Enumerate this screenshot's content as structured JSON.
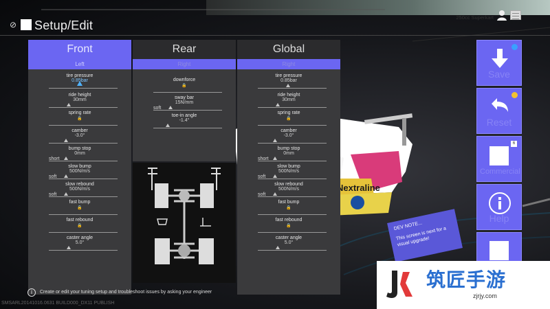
{
  "app": {
    "title": "Setup/Edit",
    "user_label": "250cc Superkart",
    "build_info": "SMSARL20141016.0631 BUILD000_DX11 PUBLISH"
  },
  "panels": [
    {
      "header": "Front",
      "sub": "Left",
      "active": true,
      "params": [
        {
          "label": "tire pressure",
          "value": "0.85bar",
          "highlight": true
        },
        {
          "label": "ride height",
          "value": "30mm"
        },
        {
          "label": "spring rate",
          "value": "",
          "locked": true
        },
        {
          "label": "camber",
          "value": "-3.0°"
        },
        {
          "label": "bump stop",
          "value": "0mm",
          "side": "short"
        },
        {
          "label": "slow bump",
          "value": "500N/m/s",
          "side": "soft"
        },
        {
          "label": "slow rebound",
          "value": "500N/m/s",
          "side": "soft"
        },
        {
          "label": "fast bump",
          "value": "",
          "locked": true
        },
        {
          "label": "fast rebound",
          "value": "",
          "locked": true
        },
        {
          "label": "caster angle",
          "value": "5.0°"
        }
      ]
    },
    {
      "header": "Rear",
      "sub": "Right",
      "active": false,
      "params": [
        {
          "label": "downforce",
          "value": "",
          "locked": true
        },
        {
          "label": "sway bar",
          "value": "15N/mm",
          "side": "soft"
        },
        {
          "label": "toe-in angle",
          "value": "-1.4°"
        }
      ]
    },
    {
      "header": "Global",
      "sub": "Right",
      "active": false,
      "params": [
        {
          "label": "tire pressure",
          "value": "0.85bar"
        },
        {
          "label": "ride height",
          "value": "30mm"
        },
        {
          "label": "spring rate",
          "value": "",
          "locked": true
        },
        {
          "label": "camber",
          "value": "-3.0°"
        },
        {
          "label": "bump stop",
          "value": "0mm",
          "side": "short"
        },
        {
          "label": "slow bump",
          "value": "500N/m/s",
          "side": "soft"
        },
        {
          "label": "slow rebound",
          "value": "500N/m/s",
          "side": "soft"
        },
        {
          "label": "fast bump",
          "value": "",
          "locked": true
        },
        {
          "label": "fast rebound",
          "value": "",
          "locked": true
        },
        {
          "label": "caster angle",
          "value": "5.0°"
        }
      ]
    }
  ],
  "side_buttons": [
    {
      "label": "Save",
      "icon": "arrow-down-icon",
      "dot_color": "#3aa0ff"
    },
    {
      "label": "Reset",
      "icon": "undo-icon",
      "dot_color": "#f2c230"
    },
    {
      "label": "Commercial",
      "icon": "square-icon",
      "badge": "6"
    },
    {
      "label": "Help",
      "icon": "info-icon"
    },
    {
      "label": "",
      "icon": "square-icon"
    }
  ],
  "dev_note": {
    "title": "DEV NOTE...",
    "body": "This screen is next for a visual upgrade!"
  },
  "info_text": "Create or edit your tuning setup and troubleshoot issues by asking your engineer",
  "car_sponsor": "Nextraline",
  "watermark": {
    "text": "筑匠手游",
    "url": "zjrjy.com"
  },
  "colors": {
    "accent": "#6b66f2",
    "panel_bg": "#3a3a3c",
    "highlight": "#4fb3ff",
    "save_dot": "#3aa0ff",
    "reset_dot": "#f2c230"
  }
}
